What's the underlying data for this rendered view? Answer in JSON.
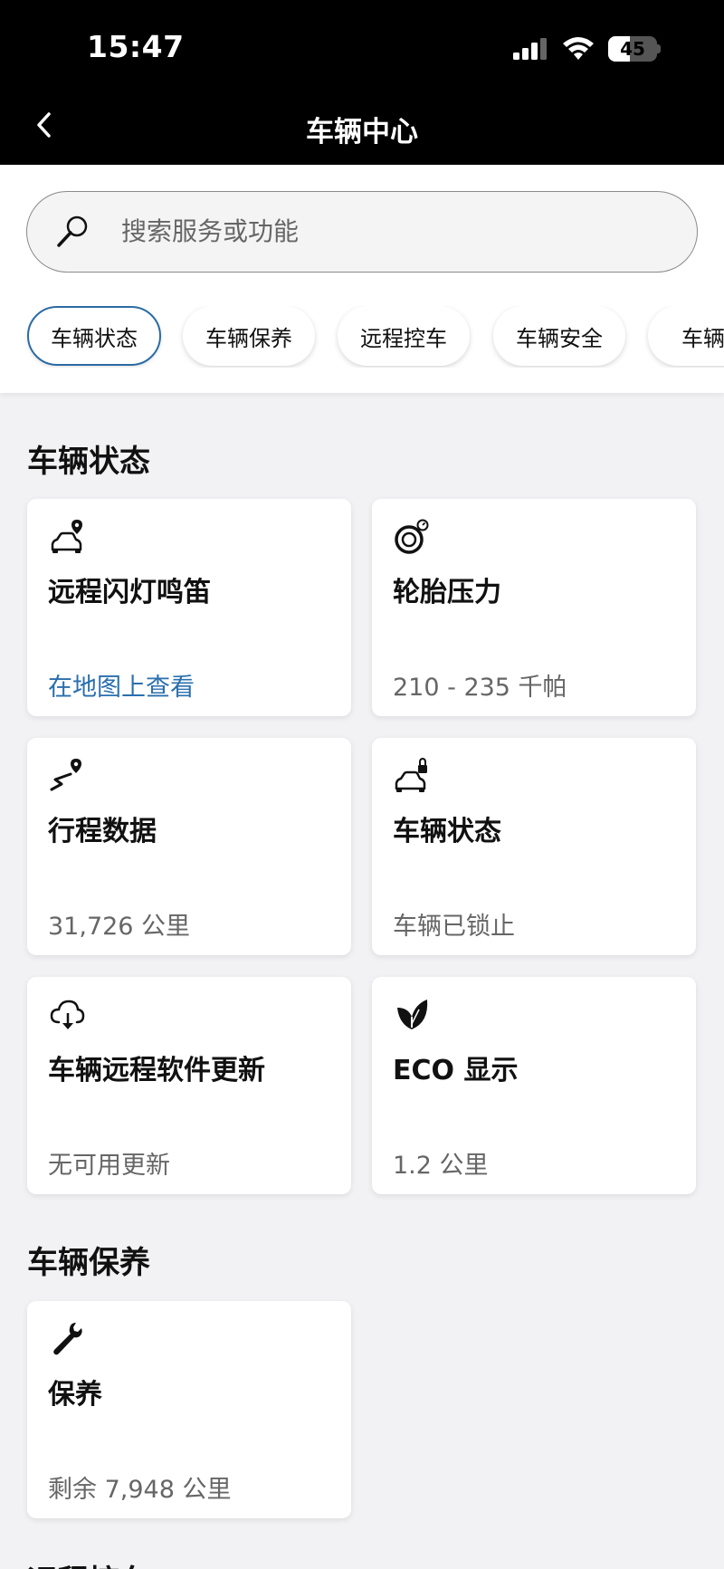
{
  "status_bar": {
    "time": "15:47",
    "battery": "45",
    "battery_level": 0.45
  },
  "nav": {
    "title": "车辆中心"
  },
  "search": {
    "placeholder": "搜索服务或功能"
  },
  "chips": [
    "车辆状态",
    "车辆保养",
    "远程控车",
    "车辆安全",
    "车辆设"
  ],
  "sections": [
    {
      "title": "车辆状态"
    },
    {
      "title": "车辆保养"
    },
    {
      "title": "远程控车"
    }
  ],
  "cards": [
    {
      "icon": "car-location-icon",
      "title": "远程闪灯鸣笛",
      "subtitle": "在地图上查看"
    },
    {
      "icon": "tire-pressure-icon",
      "title": "轮胎压力",
      "subtitle": "210 - 235 千帕"
    },
    {
      "icon": "trip-route-icon",
      "title": "行程数据",
      "subtitle": "31,726 公里"
    },
    {
      "icon": "car-lock-icon",
      "title": "车辆状态",
      "subtitle": "车辆已锁止"
    },
    {
      "icon": "cloud-download-icon",
      "title": "车辆远程软件更新",
      "subtitle": "无可用更新"
    },
    {
      "icon": "leaf-icon",
      "title": "ECO 显示",
      "subtitle": "1.2 公里"
    },
    {
      "icon": "wrench-icon",
      "title": "保养",
      "subtitle": "剩余 7,948 公里"
    }
  ],
  "colors": {
    "accent": "#2a6fad",
    "nav_bg": "#000000",
    "page_bg": "#f2f2f4"
  }
}
